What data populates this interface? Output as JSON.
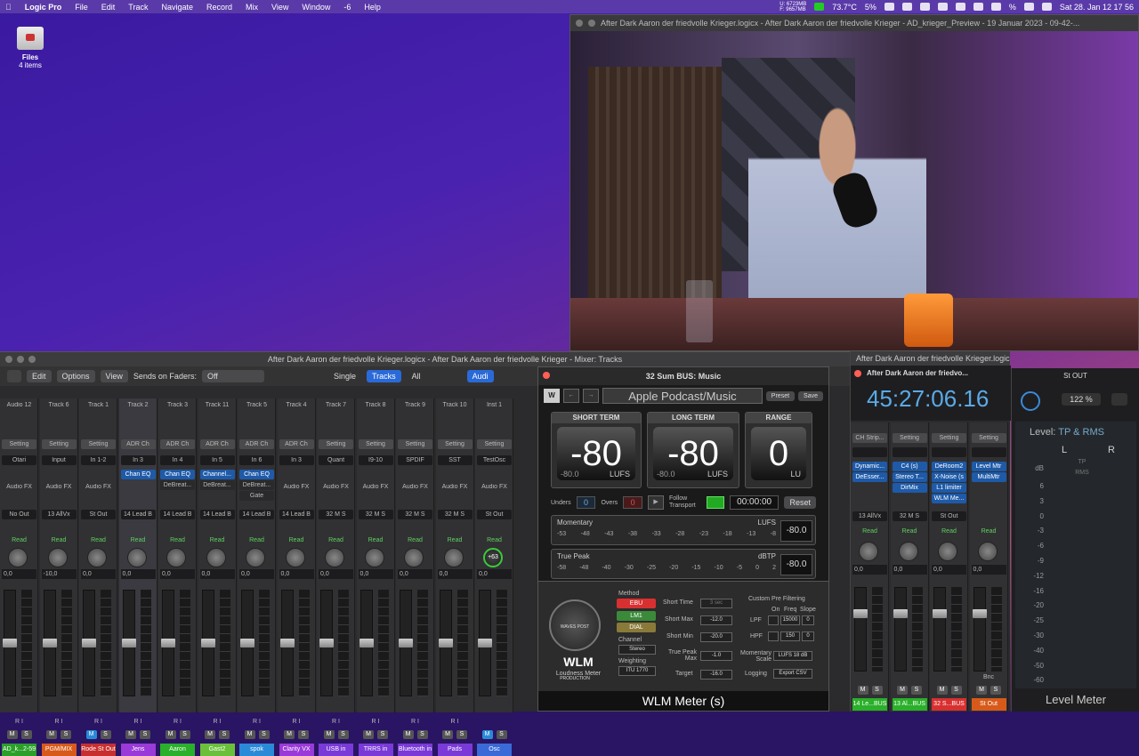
{
  "menubar": {
    "app": "Logic Pro",
    "items": [
      "File",
      "Edit",
      "Track",
      "Navigate",
      "Record",
      "Mix",
      "View",
      "Window",
      "-6",
      "Help"
    ],
    "mem_u": "U: 6723MB",
    "mem_f": "F: 9657MB",
    "temp": "73.7°C",
    "cpu": "5%",
    "battery": "%",
    "datetime": "Sat 28. Jan  12 17 56"
  },
  "desktop": {
    "folder": "Files",
    "count": "4 items"
  },
  "video_window": {
    "title": "After Dark Aaron der friedvolle Krieger.logicx - After Dark Aaron der friedvolle Krieger - AD_krieger_Preview - 19 Januar 2023 - 09-42-..."
  },
  "mixer": {
    "title": "After Dark Aaron der friedvolle Krieger.logicx - After Dark Aaron der friedvolle Krieger - Mixer: Tracks",
    "edit": "Edit",
    "options": "Options",
    "view": "View",
    "sends_label": "Sends on Faders:",
    "sends_value": "Off",
    "view_single": "Single",
    "view_tracks": "Tracks",
    "view_all": "All",
    "audio_btn": "Audi",
    "strips": [
      {
        "top": "Audio 12",
        "setting": "Setting",
        "input": "Otari",
        "fx": "",
        "fx2": "",
        "fx3": "",
        "afx": "Audio FX",
        "out": "No Out",
        "read": "Read",
        "val": "0,0",
        "name": "AD_k...2-59",
        "color": "#2aa02a",
        "ri": "R I"
      },
      {
        "top": "Track 6",
        "setting": "Setting",
        "input": "Input",
        "fx": "",
        "fx2": "",
        "fx3": "",
        "afx": "Audio FX",
        "out": "13 AllVx",
        "read": "Read",
        "val": "-10,0",
        "name": "PGM/MIX",
        "color": "#d85a1a",
        "ri": "R I"
      },
      {
        "top": "Track 1",
        "setting": "Setting",
        "input": "In 1-2",
        "fx": "",
        "fx2": "",
        "fx3": "",
        "afx": "Audio FX",
        "out": "St Out",
        "read": "Read",
        "val": "0,0",
        "name": "Rode St Out",
        "color": "#c83030",
        "ri": "R I"
      },
      {
        "top": "Track 2",
        "setting": "ADR Ch",
        "input": "In 3",
        "fx": "Chan EQ",
        "fx2": "",
        "fx3": "",
        "afx": "",
        "out": "14 Lead B",
        "read": "Read",
        "val": "0,0",
        "name": "Jens",
        "color": "#9a3ad8",
        "ri": "R I"
      },
      {
        "top": "Track 3",
        "setting": "ADR Ch",
        "input": "In 4",
        "fx": "Chan EQ",
        "fx2": "DeBreat...",
        "fx3": "",
        "afx": "",
        "out": "14 Lead B",
        "read": "Read",
        "val": "0,0",
        "name": "Aaron",
        "color": "#2ab02a",
        "ri": "R I"
      },
      {
        "top": "Track 11",
        "setting": "ADR Ch",
        "input": "In 5",
        "fx": "Channel...",
        "fx2": "DeBreat...",
        "fx3": "",
        "afx": "",
        "out": "14 Lead B",
        "read": "Read",
        "val": "0,0",
        "name": "Gast2",
        "color": "#6ac03a",
        "ri": "R I"
      },
      {
        "top": "Track 5",
        "setting": "ADR Ch",
        "input": "In 6",
        "fx": "Chan EQ",
        "fx2": "DeBreat...",
        "fx3": "Gate",
        "afx": "",
        "out": "14 Lead B",
        "read": "Read",
        "val": "0,0",
        "name": "spok",
        "color": "#2a8ad8",
        "ri": "R I"
      },
      {
        "top": "Track 4",
        "setting": "ADR Ch",
        "input": "In 3",
        "fx": "",
        "fx2": "",
        "fx3": "",
        "afx": "Audio FX",
        "out": "14 Lead B",
        "read": "Read",
        "val": "0,0",
        "name": "Clarity VX",
        "color": "#9a3ad8",
        "ri": "R I"
      },
      {
        "top": "Track 7",
        "setting": "Setting",
        "input": "Quant",
        "fx": "",
        "fx2": "",
        "fx3": "",
        "afx": "Audio FX",
        "out": "32 M S",
        "read": "Read",
        "val": "0,0",
        "name": "USB in",
        "color": "#7a3ad8",
        "ri": "R I"
      },
      {
        "top": "Track 8",
        "setting": "Setting",
        "input": "I9-10",
        "fx": "",
        "fx2": "",
        "fx3": "",
        "afx": "Audio FX",
        "out": "32 M S",
        "read": "Read",
        "val": "0,0",
        "name": "TRRS in",
        "color": "#7a3ad8",
        "ri": "R I"
      },
      {
        "top": "Track 9",
        "setting": "Setting",
        "input": "SPDIF",
        "fx": "",
        "fx2": "",
        "fx3": "",
        "afx": "Audio FX",
        "out": "32 M S",
        "read": "Read",
        "val": "0,0",
        "name": "Bluetooth in",
        "color": "#7a3ad8",
        "ri": "R I"
      },
      {
        "top": "Track 10",
        "setting": "Setting",
        "input": "SST",
        "fx": "",
        "fx2": "",
        "fx3": "",
        "afx": "Audio FX",
        "out": "32 M S",
        "read": "Read",
        "val": "0,0",
        "name": "Pads",
        "color": "#7a3ad8",
        "ri": "R I"
      },
      {
        "top": "Inst 1",
        "setting": "Setting",
        "input": "TestOsc",
        "fx": "",
        "fx2": "",
        "fx3": "",
        "afx": "Audio FX",
        "out": "St Out",
        "read": "Read",
        "val": "0,0",
        "name": "Osc",
        "color": "#3a6ad8",
        "ri": "",
        "knob": "+63"
      }
    ],
    "m": "M",
    "s": "S"
  },
  "wlm": {
    "title": "32 Sum BUS: Music",
    "preset_name": "Apple Podcast/Music",
    "preset_btn": "Preset",
    "save_btn": "Save",
    "short_term": {
      "label": "SHORT TERM",
      "value": "-80",
      "sub": "-80.0",
      "unit": "LUFS"
    },
    "long_term": {
      "label": "LONG TERM",
      "value": "-80",
      "sub": "-80.0",
      "unit": "LUFS"
    },
    "range": {
      "label": "RANGE",
      "value": "0",
      "unit": "LU"
    },
    "unders_label": "Unders",
    "unders": "0",
    "overs_label": "Overs",
    "overs": "0",
    "follow": "Follow Transport",
    "timer": "00:00:00",
    "reset": "Reset",
    "momentary": {
      "label": "Momentary",
      "unit": "LUFS",
      "value": "-80.0",
      "scale": [
        "-53",
        "-48",
        "-43",
        "-38",
        "-33",
        "-28",
        "-23",
        "-18",
        "-13",
        "-8"
      ]
    },
    "truepeak": {
      "label": "True Peak",
      "unit": "dBTP",
      "value": "-80.0",
      "scale": [
        "-58",
        "-48",
        "-40",
        "-30",
        "-25",
        "-20",
        "-15",
        "-10",
        "-5",
        "0",
        "2"
      ]
    },
    "brand": "WAVES POST PRODUCTION",
    "name": "WLM",
    "sub": "Loudness Meter",
    "method_label": "Method",
    "ebu": "EBU",
    "lm1": "LM1",
    "dial": "DIAL",
    "channel_label": "Channel",
    "channel": "Stereo",
    "weighting_label": "Weighting",
    "weighting": "ITU 1770",
    "short_time_label": "Short Time",
    "short_time": "3 sec",
    "short_max_label": "Short Max",
    "short_max": "-12.0",
    "short_min_label": "Short Min",
    "short_min": "-20.0",
    "tp_max_label": "True Peak Max",
    "tp_max": "-1.0",
    "target_label": "Target",
    "target": "-16.0",
    "cpf_label": "Custom Pre Filtering",
    "on": "On",
    "freq": "Freq",
    "slope": "Slope",
    "lpf": "LPF",
    "lpf_freq": "15000",
    "lpf_slope": "0",
    "hpf": "HPF",
    "hpf_freq": "150",
    "hpf_slope": "0",
    "mom_scale_label": "Momentary Scale",
    "mom_scale": "LUFS 18 dB",
    "logging_label": "Logging",
    "export": "Export CSV",
    "footer": "WLM Meter (s)"
  },
  "mixer2": {
    "title": "After Dark Aaron der friedvolle Krieger.logicx - After Dark Aa",
    "time_title": "After Dark Aaron der friedvo...",
    "time": "45:27:06.16",
    "strips": [
      {
        "setting": "CH Strip...",
        "fx": "Dynamic...",
        "fx2": "DeEsser...",
        "fx3": "",
        "fx4": "",
        "out": "13 AllVx",
        "name": "14 Le...BUS",
        "color": "#2ab02a"
      },
      {
        "setting": "Setting",
        "fx": "C4 (s)",
        "fx2": "Stereo T...",
        "fx3": "DirMix",
        "fx4": "",
        "out": "32 M S",
        "name": "13 Al...BUS",
        "color": "#2ab02a"
      },
      {
        "setting": "Setting",
        "fx": "DeRoom2",
        "fx2": "X-Noise (s",
        "fx3": "L1 limiter",
        "fx4": "WLM Me...",
        "out": "St Out",
        "name": "32 S...BUS",
        "color": "#d83030"
      },
      {
        "setting": "Setting",
        "fx": "Level Mtr",
        "fx2": "MultiMtr",
        "fx3": "",
        "fx4": "",
        "out": "",
        "name": "St Out",
        "color": "#d85a1a"
      }
    ],
    "read": "Read",
    "val": "0,0",
    "bnc": "Bnc"
  },
  "stout": {
    "title": "St OUT",
    "percent": "122 %",
    "level_label": "Level:",
    "level_mode": "TP & RMS",
    "l": "L",
    "r": "R",
    "tp": "TP",
    "rms": "RMS",
    "db": "dB",
    "scale": [
      "6",
      "3",
      "0",
      "-3",
      "-6",
      "-9",
      "-12",
      "-16",
      "-20",
      "-25",
      "-30",
      "-40",
      "-50",
      "-60"
    ],
    "footer": "Level Meter"
  }
}
